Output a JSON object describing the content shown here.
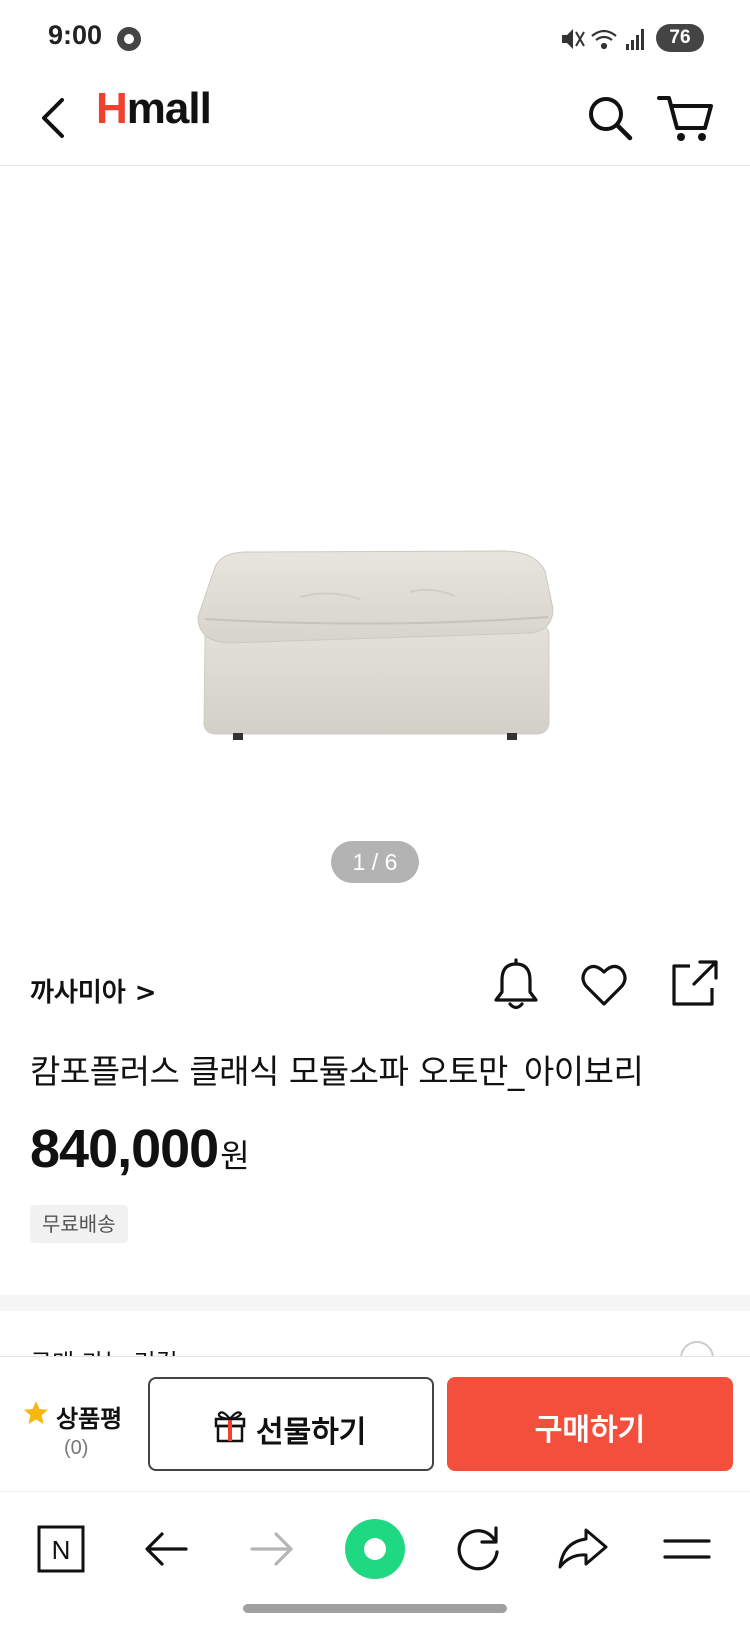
{
  "status_bar": {
    "time": "9:00",
    "battery": "76"
  },
  "header": {
    "logo_h": "H",
    "logo_rest": "mall"
  },
  "product": {
    "image_counter": "1 / 6",
    "brand": "까사미아 >",
    "title": "캄포플러스 클래식 모듈소파 오토만_아이보리",
    "price_amount": "840,000",
    "price_unit": "원",
    "shipping_badge": "무료배송",
    "next_section_label": "구매 가능 리걸"
  },
  "purchase_bar": {
    "review_label": "상품평",
    "review_count": "(0)",
    "gift_label": "선물하기",
    "buy_label": "구매하기",
    "buy_color": "#f44f3c"
  },
  "browser_bar": {
    "tab_label": "N"
  },
  "colors": {
    "brand_red": "#f0402e",
    "browser_green": "#1ed882"
  }
}
